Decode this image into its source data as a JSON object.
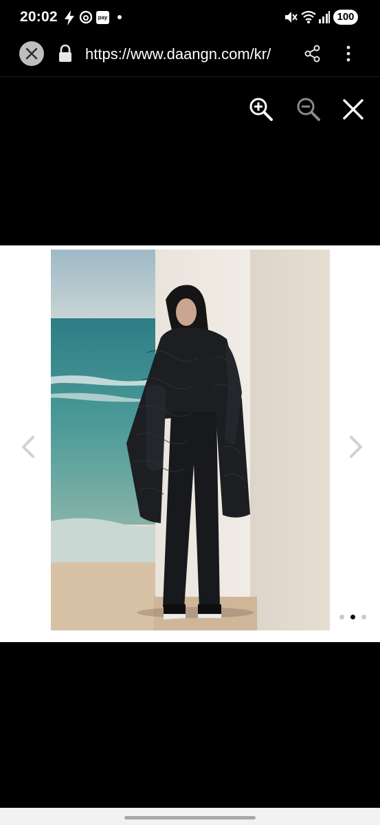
{
  "status_bar": {
    "time": "20:02",
    "pay_label": "pay",
    "battery": "100",
    "icons": [
      "bolt-icon",
      "threads-icon",
      "pay-icon",
      "notification-dot",
      "mute-icon",
      "wifi-icon",
      "signal-icon",
      "battery-icon"
    ]
  },
  "browser": {
    "url": "https://www.daangn.com/kr/",
    "icons": [
      "close-icon",
      "lock-icon",
      "share-icon",
      "more-vert-icon"
    ]
  },
  "viewer": {
    "tools": [
      "zoom-in-icon",
      "zoom-out-icon",
      "close-icon"
    ],
    "navigation": [
      "chevron-left-icon",
      "chevron-right-icon"
    ],
    "page_indicator": {
      "count": 3,
      "active_index": 1
    }
  },
  "colors": {
    "background": "#000000",
    "viewer_background": "#ffffff",
    "active_dot": "#111111",
    "inactive_dot": "#c9c9c9"
  }
}
